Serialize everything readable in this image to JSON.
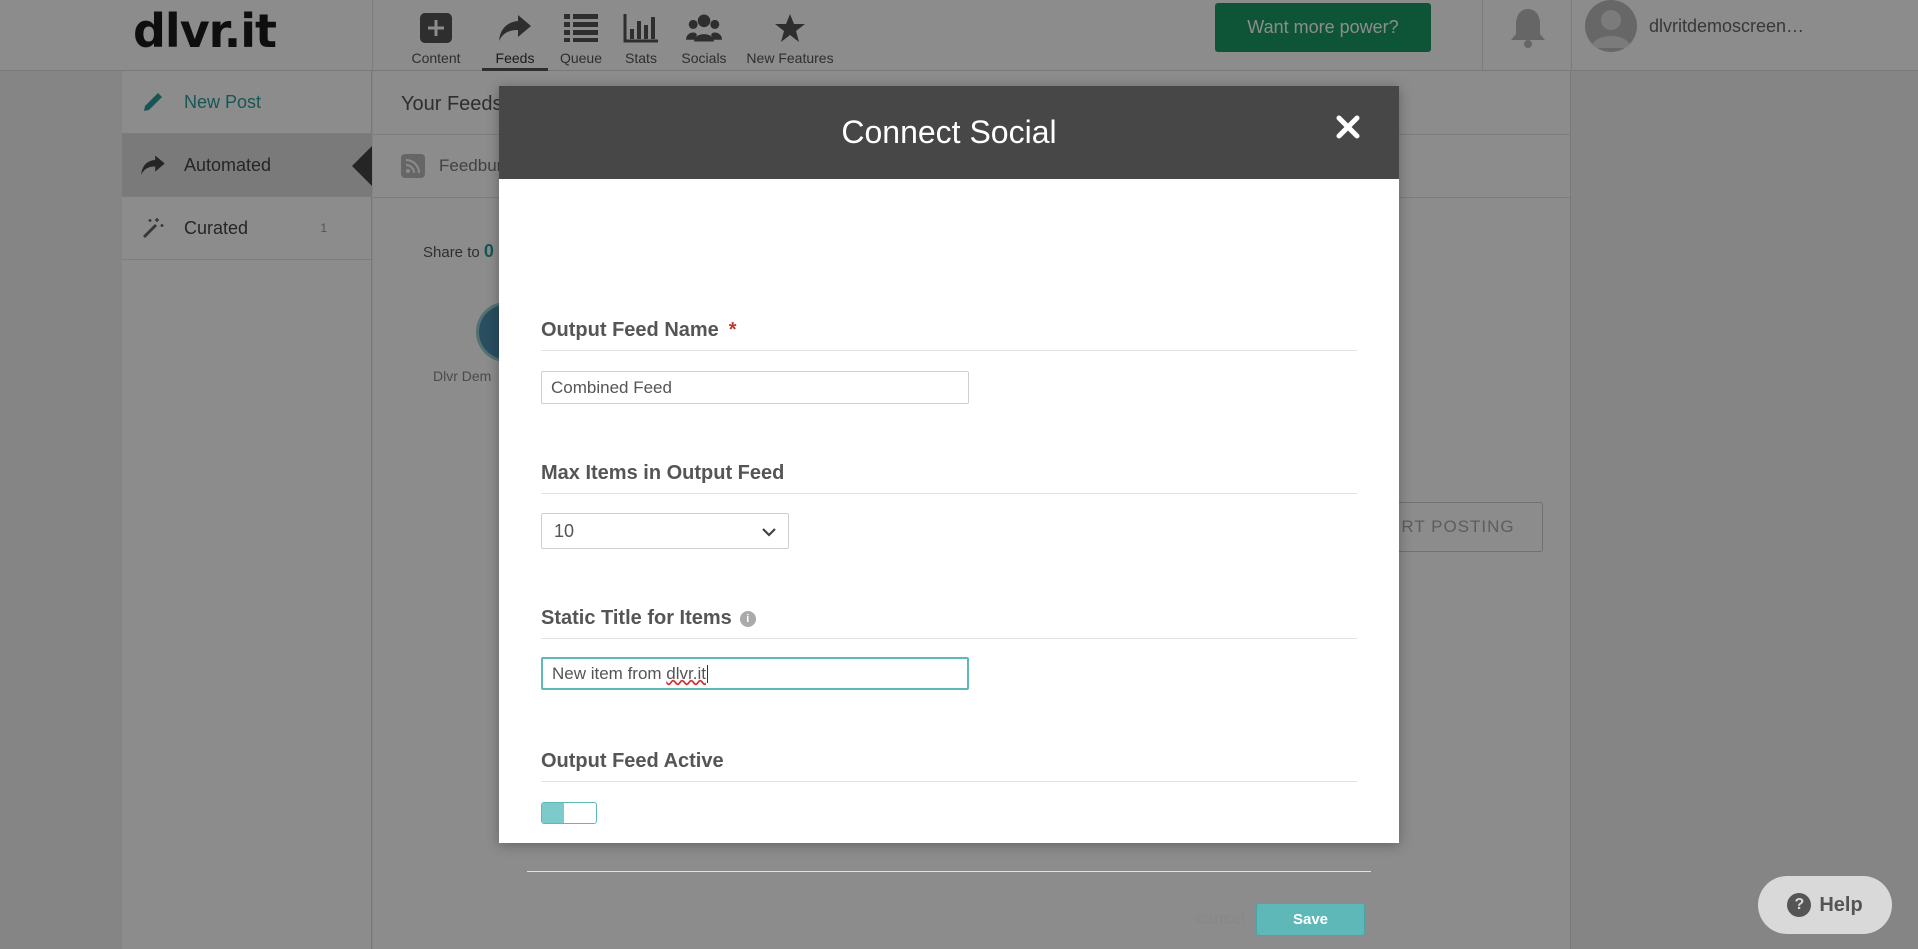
{
  "app": {
    "logo": "dlvr.it",
    "nav": [
      {
        "label": "Content",
        "icon": "plus-square-icon"
      },
      {
        "label": "Feeds",
        "icon": "share-arrow-icon",
        "active": true
      },
      {
        "label": "Queue",
        "icon": "list-icon"
      },
      {
        "label": "Stats",
        "icon": "bar-chart-icon"
      },
      {
        "label": "Socials",
        "icon": "users-icon"
      },
      {
        "label": "New Features",
        "icon": "star-icon"
      }
    ],
    "power_button": "Want more power?",
    "user_name": "dlvritdemoscreen…"
  },
  "sidebar": {
    "items": [
      {
        "label": "New Post",
        "icon": "pencil-icon"
      },
      {
        "label": "Automated",
        "icon": "share-arrow-icon",
        "active": true
      },
      {
        "label": "Curated",
        "icon": "magic-wand-icon",
        "count": "1"
      }
    ]
  },
  "main": {
    "header": "Your Feeds",
    "feed_label": "Feedbur",
    "share_prefix": "Share to",
    "share_count": "0",
    "account_label": "Dlvr Dem",
    "start_button": "RT POSTING"
  },
  "modal": {
    "title": "Connect Social",
    "fields": {
      "output_feed_name": {
        "label": "Output Feed Name",
        "required": "*",
        "value": "Combined Feed"
      },
      "max_items": {
        "label": "Max Items in Output Feed",
        "value": "10"
      },
      "static_title": {
        "label": "Static Title for Items",
        "value_prefix": "New item from ",
        "value_misspelled": "dlvr.it"
      },
      "active": {
        "label": "Output Feed Active",
        "on": true
      }
    },
    "cancel_label": "cancel",
    "save_label": "Save"
  },
  "help": {
    "label": "Help"
  },
  "colors": {
    "accent": "#5fb8b8",
    "power_green": "#1a9a63",
    "modal_header": "#474747",
    "required_red": "#c0392b"
  }
}
